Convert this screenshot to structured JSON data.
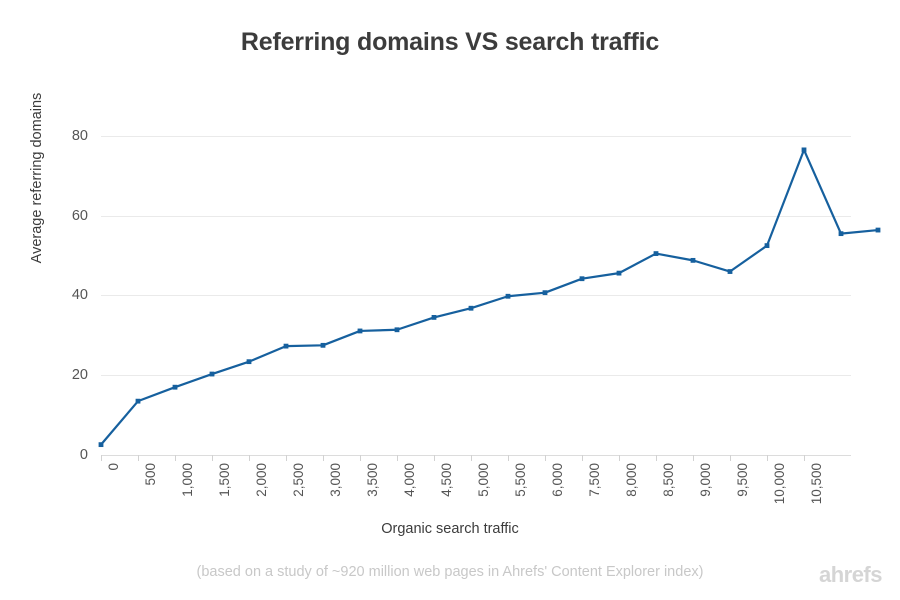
{
  "chart_data": {
    "type": "line",
    "title": "Referring domains VS search traffic",
    "xlabel": "Organic search traffic",
    "ylabel": "Average referring domains",
    "categories": [
      "0",
      "500",
      "1,000",
      "1,500",
      "2,000",
      "2,500",
      "3,000",
      "3,500",
      "4,000",
      "4,500",
      "5,000",
      "5,500",
      "6,000",
      "7,500",
      "8,000",
      "8,500",
      "9,000",
      "9,500",
      "10,000",
      "10,500"
    ],
    "values": [
      2.6,
      13.5,
      17.0,
      20.3,
      23.4,
      27.3,
      27.5,
      31.1,
      31.4,
      34.5,
      36.8,
      39.8,
      40.7,
      44.2,
      45.6,
      50.5,
      48.8,
      46.0,
      52.5,
      76.5,
      55.5,
      56.4
    ],
    "ylim": [
      0,
      86
    ],
    "yticks": [
      0,
      20,
      40,
      60,
      80
    ],
    "ytick_labels": [
      "0",
      "20",
      "40",
      "60",
      "80"
    ],
    "grid": "horizontal",
    "legend": "none",
    "series_color": "#16609e",
    "marker": "square"
  },
  "footer": {
    "note": "(based on a study of ~920 million web pages in Ahrefs' Content Explorer index)",
    "logo": "ahrefs"
  }
}
